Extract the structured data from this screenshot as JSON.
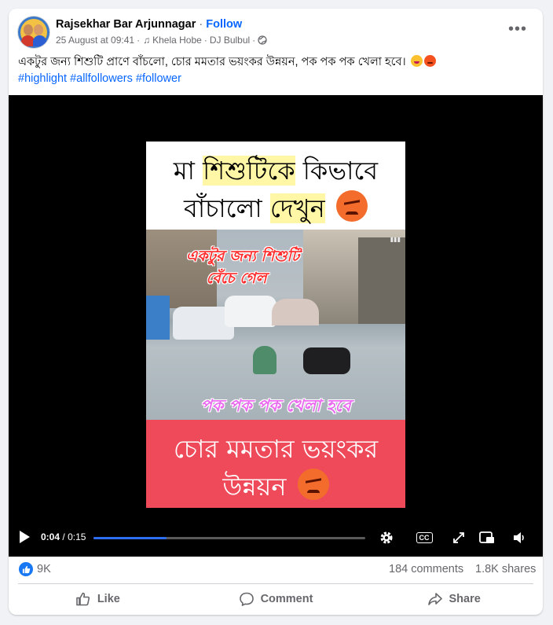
{
  "post": {
    "author": "Rajsekhar Bar Arjunnagar",
    "separator": "·",
    "follow_label": "Follow",
    "date": "25 August at 09:41",
    "meta_sep": "·",
    "music_track": "Khela Hobe",
    "music_artist": "DJ Bulbul",
    "caption": "একটুর জন্য শিশুটি প্রাণে বাঁচলো, চোর মমতার ভয়ংকর উন্নয়ন, পক পক পক খেলা হবে।",
    "hashtags": [
      "#highlight",
      "#allfollowers",
      "#follower"
    ]
  },
  "video": {
    "top_line1_pre": "মা ",
    "top_line1_hl": "শিশুটিকে",
    "top_line1_post": " কিভাবে",
    "top_line2_pre": "বাঁচালো ",
    "top_line2_hl": "দেখুন",
    "scene_text1": "একটুর জন্য শিশুটি",
    "scene_text2": "বেঁচে গেল",
    "scene_text3": "পক পক পক খেলা হবে",
    "bottom_line1": "চোর মমতার ভয়ংকর",
    "bottom_line2": "উন্নয়ন",
    "current_time": "0:04",
    "time_sep": "/",
    "duration": "0:15",
    "progress": 0.27
  },
  "stats": {
    "likes": "9K",
    "comments": "184 comments",
    "shares": "1.8K shares"
  },
  "actions": {
    "like": "Like",
    "comment": "Comment",
    "share": "Share"
  },
  "colors": {
    "accent": "#0866ff",
    "like_blue": "#1877f2",
    "banner_red": "#ef4a5a",
    "highlight": "#fff6a6"
  }
}
